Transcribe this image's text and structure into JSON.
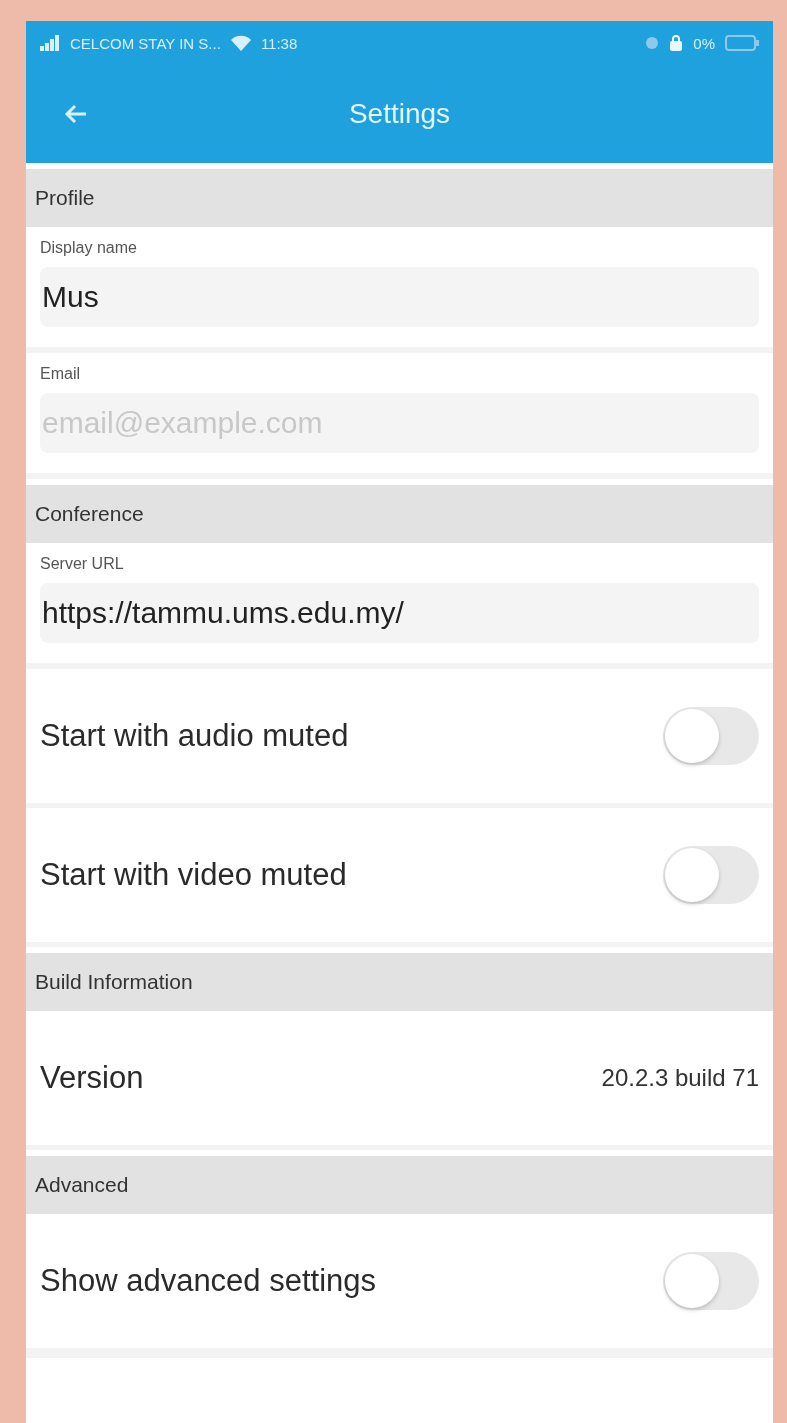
{
  "status_bar": {
    "carrier": "CELCOM STAY IN S...",
    "time": "11:38",
    "battery": "0%"
  },
  "header": {
    "title": "Settings"
  },
  "sections": [
    {
      "title": "Profile",
      "items": [
        {
          "kind": "field",
          "label": "Display name",
          "value": "Mus"
        },
        {
          "kind": "field",
          "label": "Email",
          "placeholder": "email@example.com"
        }
      ]
    },
    {
      "title": "Conference",
      "items": [
        {
          "kind": "field",
          "label": "Server URL",
          "value": "https://tammu.ums.edu.my/"
        },
        {
          "kind": "toggle",
          "label": "Start with audio muted",
          "on": false
        },
        {
          "kind": "toggle",
          "label": "Start with video muted",
          "on": false
        }
      ]
    },
    {
      "title": "Build Information",
      "items": [
        {
          "kind": "info",
          "label": "Version",
          "value": "20.2.3 build 71"
        }
      ]
    },
    {
      "title": "Advanced",
      "items": [
        {
          "kind": "toggle",
          "label": "Show advanced settings",
          "on": false
        }
      ]
    }
  ]
}
